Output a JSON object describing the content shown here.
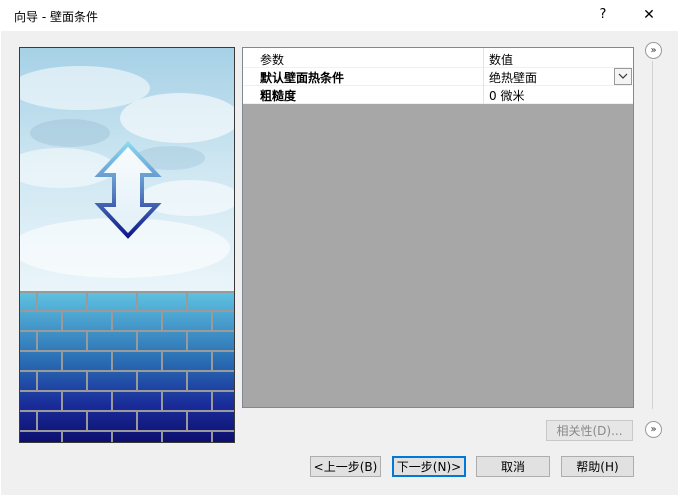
{
  "window": {
    "title": "向导 - 壁面条件",
    "help_glyph": "?",
    "close_glyph": "✕"
  },
  "grid": {
    "columns": [
      "参数",
      "数值"
    ],
    "rows": [
      {
        "name": "默认壁面热条件",
        "value": "绝热壁面",
        "has_dropdown": true
      },
      {
        "name": "粗糙度",
        "value": "0 微米",
        "has_dropdown": false
      }
    ]
  },
  "side": {
    "top_glyph": "»",
    "bottom_glyph": "»"
  },
  "buttons": {
    "relevance": "相关性(D)...",
    "prev": "<上一步(B)",
    "next": "下一步(N)>",
    "cancel": "取消",
    "help": "帮助(H)"
  },
  "colors": {
    "sky_top": "#a9d3e6",
    "sky_bottom": "#e8f3f8",
    "brick_top": "#5fc0de",
    "brick_bottom": "#0d1070",
    "arrow_top": "#7fd0ec",
    "arrow_bottom": "#111a87"
  }
}
